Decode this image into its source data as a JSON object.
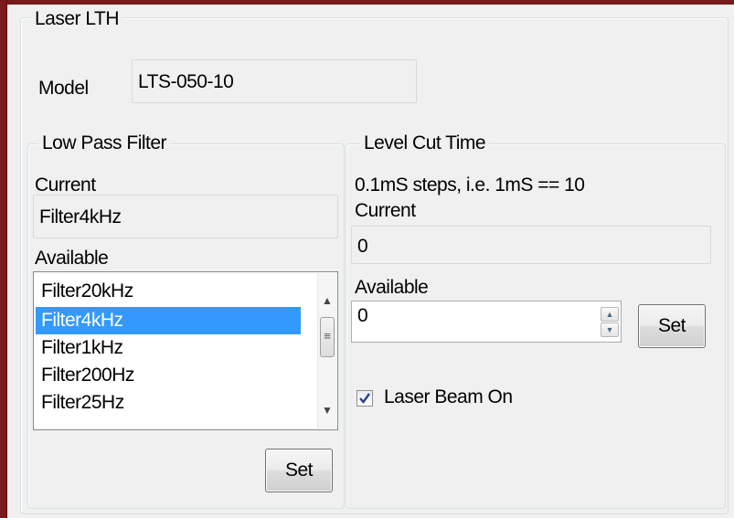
{
  "laser_group": {
    "title": "Laser LTH",
    "model_label": "Model",
    "model_value": "LTS-050-10"
  },
  "low_pass": {
    "title": "Low Pass Filter",
    "current_label": "Current",
    "current_value": "Filter4kHz",
    "available_label": "Available",
    "items": [
      {
        "label": "Filter20kHz",
        "selected": false
      },
      {
        "label": "Filter4kHz",
        "selected": true
      },
      {
        "label": "Filter1kHz",
        "selected": false
      },
      {
        "label": "Filter200Hz",
        "selected": false
      },
      {
        "label": "Filter25Hz",
        "selected": false
      }
    ],
    "set_label": "Set"
  },
  "level_cut": {
    "title": "Level Cut Time",
    "note": "0.1mS steps, i.e. 1mS == 10",
    "current_label": "Current",
    "current_value": "0",
    "available_label": "Available",
    "available_value": "0",
    "set_label": "Set"
  },
  "beam": {
    "label": "Laser Beam On",
    "checked": true
  },
  "icons": {
    "scroll_up": "chevron-up-icon",
    "scroll_down": "chevron-down-icon",
    "spin_up": "spin-up-icon",
    "spin_down": "spin-down-icon",
    "check": "checkmark-icon"
  },
  "colors": {
    "frame": "#7a1a1a",
    "selection": "#3399ff",
    "panel": "#f0f0f0"
  }
}
